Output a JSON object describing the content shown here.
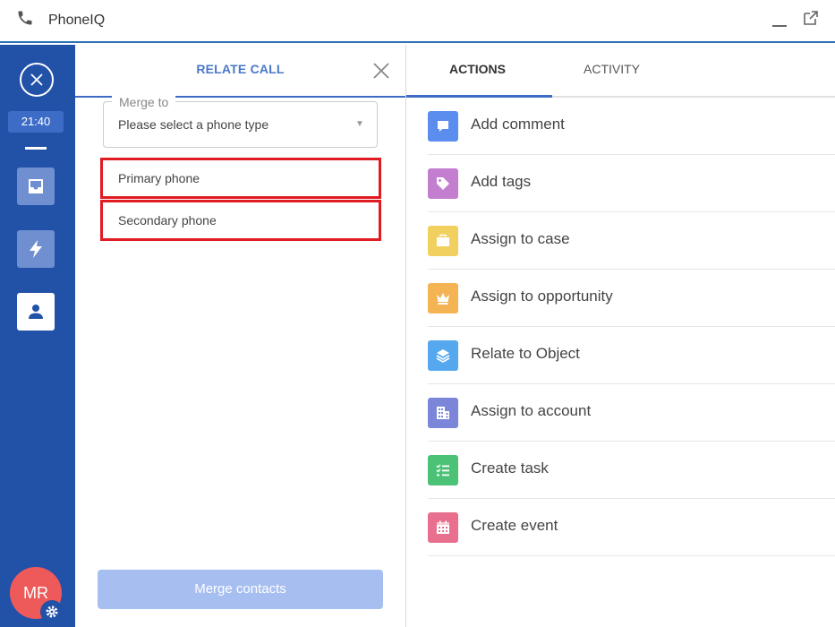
{
  "window": {
    "title": "PhoneIQ"
  },
  "rail": {
    "timer": "21:40",
    "avatar_initials": "MR"
  },
  "relate_panel": {
    "title": "RELATE CALL",
    "merge_label": "Merge to",
    "merge_placeholder": "Please select a phone type",
    "options": [
      {
        "label": "Primary phone"
      },
      {
        "label": "Secondary phone"
      }
    ],
    "merge_button": "Merge contacts"
  },
  "actions_panel": {
    "tabs": [
      {
        "label": "ACTIONS",
        "active": true
      },
      {
        "label": "ACTIVITY",
        "active": false
      }
    ],
    "items": [
      {
        "label": "Add comment",
        "icon": "comment-icon",
        "color": "#5b8def"
      },
      {
        "label": "Add tags",
        "icon": "tag-icon",
        "color": "#c37ed0"
      },
      {
        "label": "Assign to case",
        "icon": "briefcase-icon",
        "color": "#f2d060"
      },
      {
        "label": "Assign to opportunity",
        "icon": "crown-icon",
        "color": "#f5b454"
      },
      {
        "label": "Relate to Object",
        "icon": "layers-icon",
        "color": "#56a8ee"
      },
      {
        "label": "Assign to account",
        "icon": "building-icon",
        "color": "#7b86d9"
      },
      {
        "label": "Create task",
        "icon": "task-list-icon",
        "color": "#4cc277"
      },
      {
        "label": "Create event",
        "icon": "calendar-icon",
        "color": "#e8708e"
      }
    ]
  },
  "colors": {
    "rail_bg": "#2251a8",
    "accent": "#3c6cc6",
    "highlight_border": "#e01b22",
    "merge_button_bg": "#a7bef0",
    "avatar_bg": "#ee5a5a"
  }
}
